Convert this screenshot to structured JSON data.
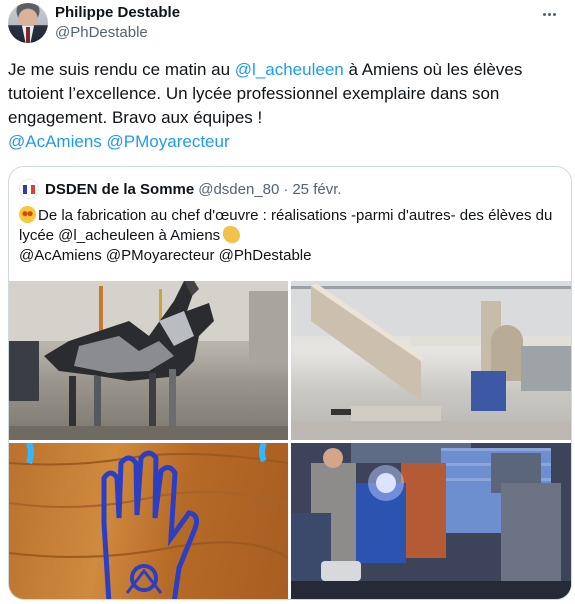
{
  "author": {
    "name": "Philippe Destable",
    "handle": "@PhDestable"
  },
  "tweet": {
    "t1": "Je me suis rendu ce matin au ",
    "mention1": "@l_acheuleen",
    "t2": " à Amiens où les élèves tutoient l’excellence. Un lycée professionnel exemplaire dans son engagement. Bravo aux équipes !",
    "mention2": "@AcAmiens",
    "mention3": "@PMoyarecteur"
  },
  "quote": {
    "name": "DSDEN de la Somme",
    "handle": "@dsden_80",
    "separator": "·",
    "date": "25 févr.",
    "line1": "De la fabrication au chef d'œuvre : réalisations -parmi d'autres- des élèves du lycée @l_acheuleen à Amiens",
    "line2": "@AcAmiens @PMoyarecteur @PhDestable"
  },
  "icons": {
    "more": "more-horizontal-icon",
    "flag": "french-flag-avatar",
    "emoji1": "star-struck-emoji",
    "emoji2": "clapping-hands-emoji"
  },
  "colors": {
    "mention": "#1d9bf0",
    "secondary": "#536471",
    "border": "#cfd9de"
  }
}
